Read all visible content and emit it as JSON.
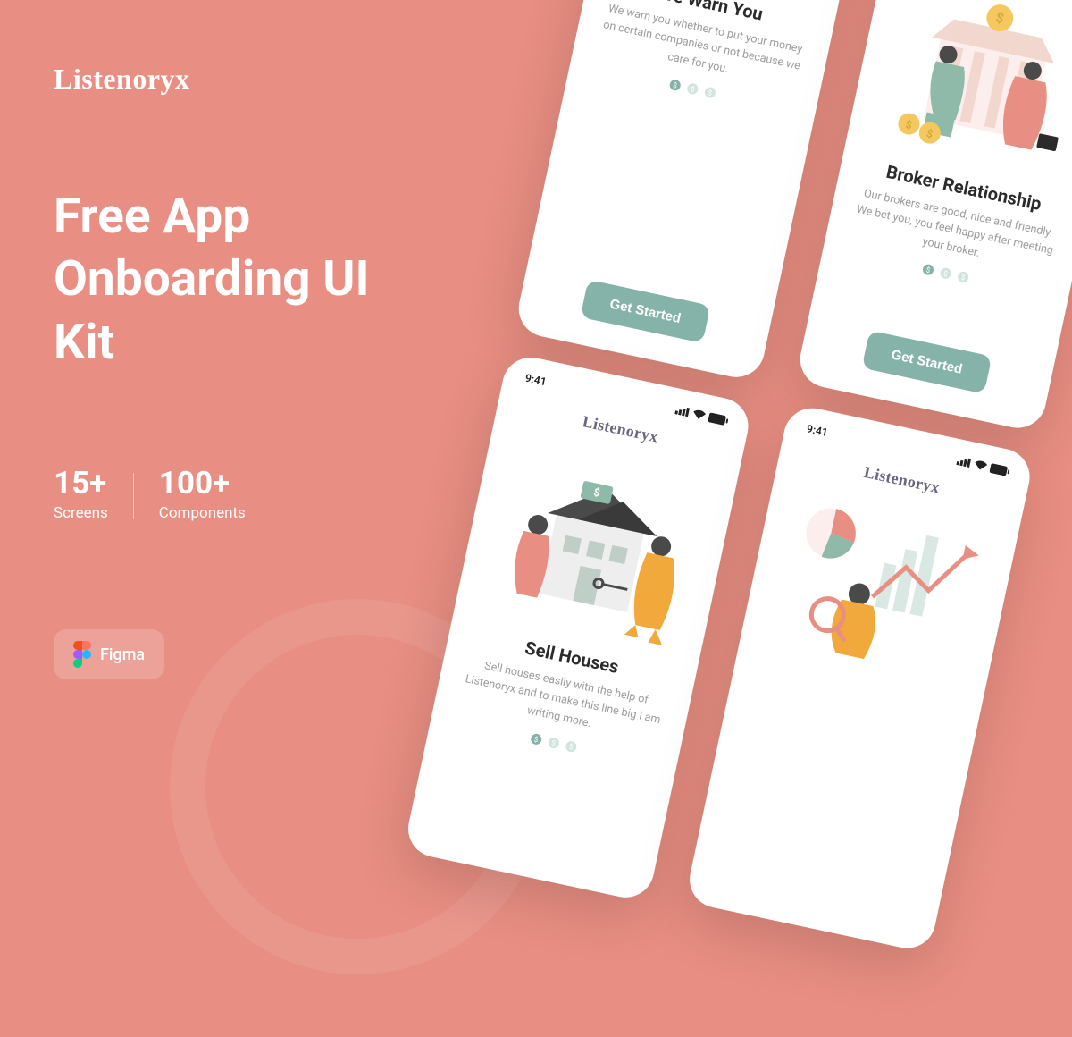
{
  "brand": "Listenoryx",
  "hero": "Free App Onboarding UI Kit",
  "stats": {
    "screens_count": "15+",
    "screens_label": "Screens",
    "components_count": "100+",
    "components_label": "Components"
  },
  "figma_label": "Figma",
  "status_time": "9:41",
  "cta_label": "Get Started",
  "cards": {
    "warn": {
      "title": "We Warn You",
      "desc": "We warn you whether to put your money on certain companies or not because we care for you."
    },
    "broker": {
      "title": "Broker Relationship",
      "desc": "Our brokers are good, nice and friendly. We bet you, you feel happy after meeting your broker."
    },
    "sell": {
      "title": "Sell Houses",
      "desc": "Sell houses easily with the help of Listenoryx and to make this line big I am writing more."
    }
  },
  "colors": {
    "bg": "#e88e82",
    "accent": "#86b3a9",
    "text_dark": "#2b2b2b"
  }
}
